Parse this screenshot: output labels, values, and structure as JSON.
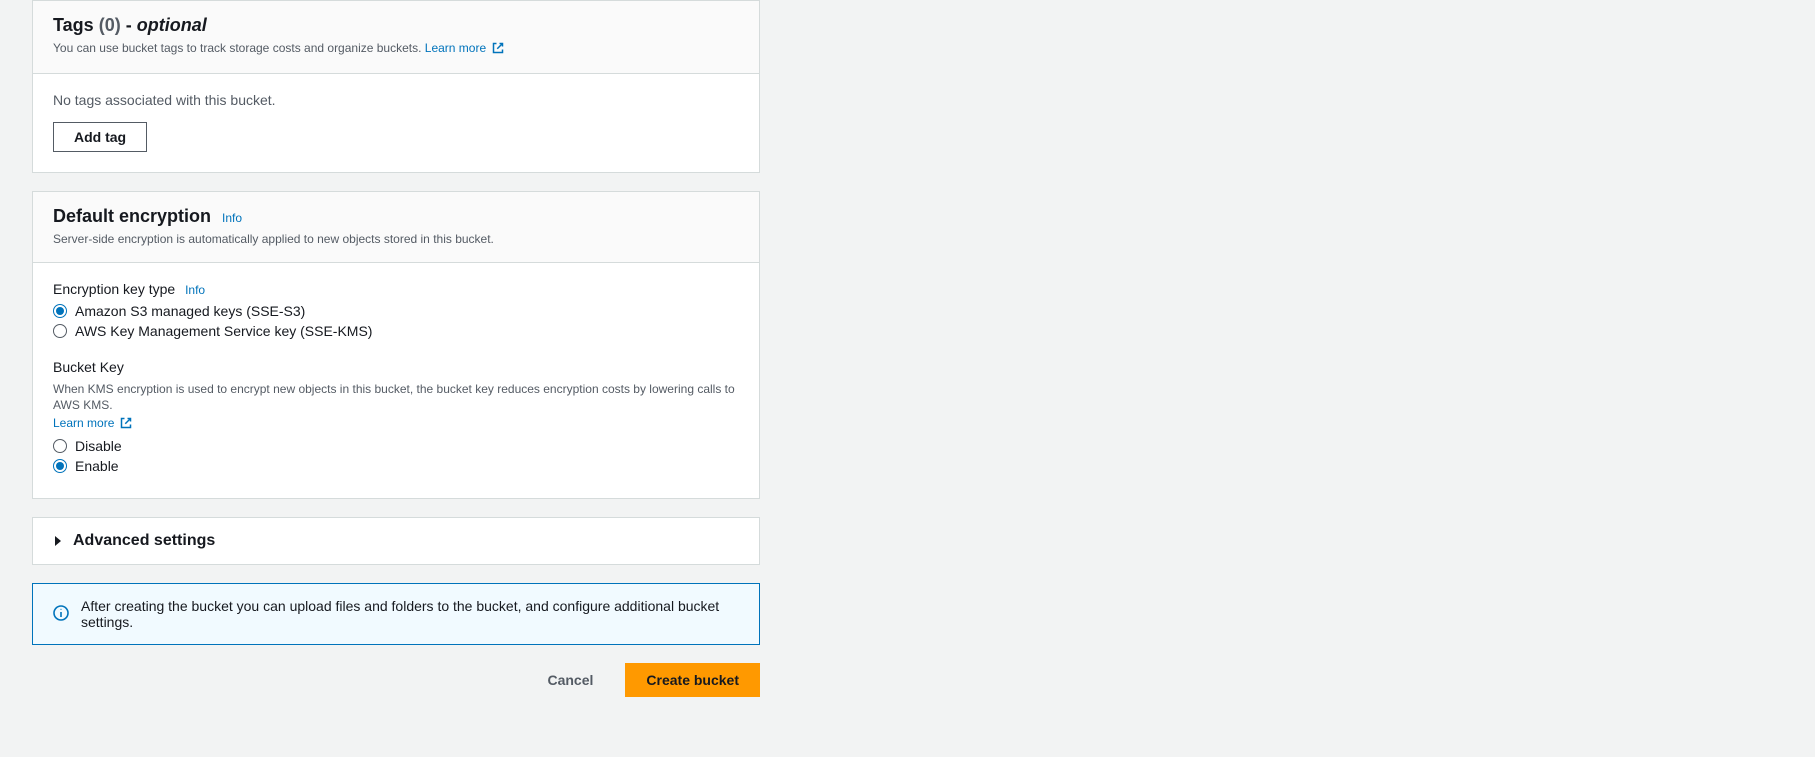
{
  "tags": {
    "title": "Tags",
    "count": "(0)",
    "sep": " - ",
    "optional": "optional",
    "desc": "You can use bucket tags to track storage costs and organize buckets. ",
    "learn_more": "Learn more",
    "empty": "No tags associated with this bucket.",
    "add_btn": "Add tag"
  },
  "encryption": {
    "title": "Default encryption",
    "info": "Info",
    "desc": "Server-side encryption is automatically applied to new objects stored in this bucket.",
    "key_type_label": "Encryption key type",
    "key_type_info": "Info",
    "option_sse_s3": "Amazon S3 managed keys (SSE-S3)",
    "option_sse_kms": "AWS Key Management Service key (SSE-KMS)",
    "bucket_key_label": "Bucket Key",
    "bucket_key_desc": "When KMS encryption is used to encrypt new objects in this bucket, the bucket key reduces encryption costs by lowering calls to AWS KMS.",
    "bucket_key_learn_more": "Learn more",
    "bk_disable": "Disable",
    "bk_enable": "Enable"
  },
  "advanced": {
    "title": "Advanced settings"
  },
  "banner": {
    "text": "After creating the bucket you can upload files and folders to the bucket, and configure additional bucket settings."
  },
  "actions": {
    "cancel": "Cancel",
    "create": "Create bucket"
  }
}
